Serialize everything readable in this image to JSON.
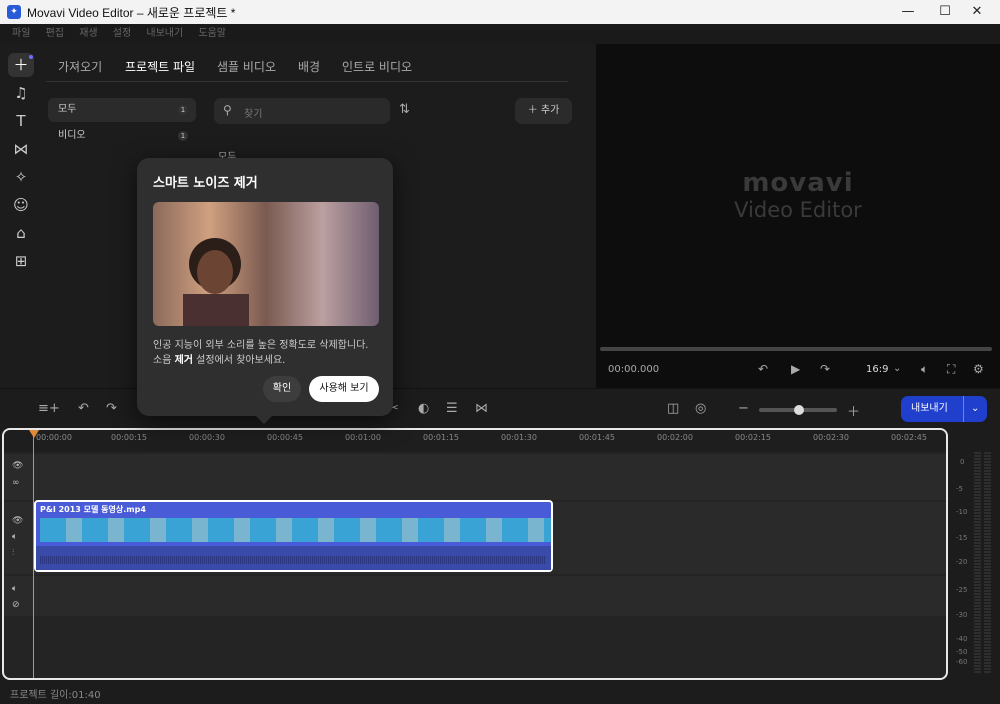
{
  "window": {
    "title": "Movavi Video Editor – 새로운 프로젝트 *"
  },
  "menu": [
    "파일",
    "편집",
    "재생",
    "설정",
    "내보내기",
    "도움말"
  ],
  "tabs": {
    "import": "가져오기",
    "project_files": "프로젝트 파일",
    "sample_videos": "샘플 비디오",
    "backgrounds": "배경",
    "intro_videos": "인트로 비디오"
  },
  "categories": [
    {
      "label": "모두",
      "count": "1"
    },
    {
      "label": "비디오",
      "count": "1"
    }
  ],
  "search": {
    "placeholder": "찾기"
  },
  "add_label": "추가",
  "media_group_label": "모두",
  "watermark": {
    "line1": "movavi",
    "line2": "Video Editor"
  },
  "preview": {
    "timecode": "00:00.000",
    "aspect": "16:9"
  },
  "popup": {
    "title": "스마트 노이즈 제거",
    "text_before": "인공 지능이 외부 소리를 높은 정확도로 삭제합니다. 소음 ",
    "text_bold": "제거",
    "text_after": " 설정에서 찾아보세요.",
    "confirm": "확인",
    "try": "사용해 보기"
  },
  "export_label": "내보내기",
  "ruler_ticks": [
    "00:00:00",
    "00:00:15",
    "00:00:30",
    "00:00:45",
    "00:01:00",
    "00:01:15",
    "00:01:30",
    "00:01:45",
    "00:02:00",
    "00:02:15",
    "00:02:30",
    "00:02:45"
  ],
  "clip": {
    "name": "P&I 2013 모델 동영상.mp4"
  },
  "meter_labels": [
    "0",
    "-5",
    "-10",
    "-15",
    "-20",
    "-25",
    "-30",
    "-40",
    "-50",
    "-60"
  ],
  "status": "프로젝트 길이:01:40",
  "colors": {
    "accent": "#1f3fcc",
    "playhead": "#e08a3c",
    "clip": "#4a5bd8"
  }
}
